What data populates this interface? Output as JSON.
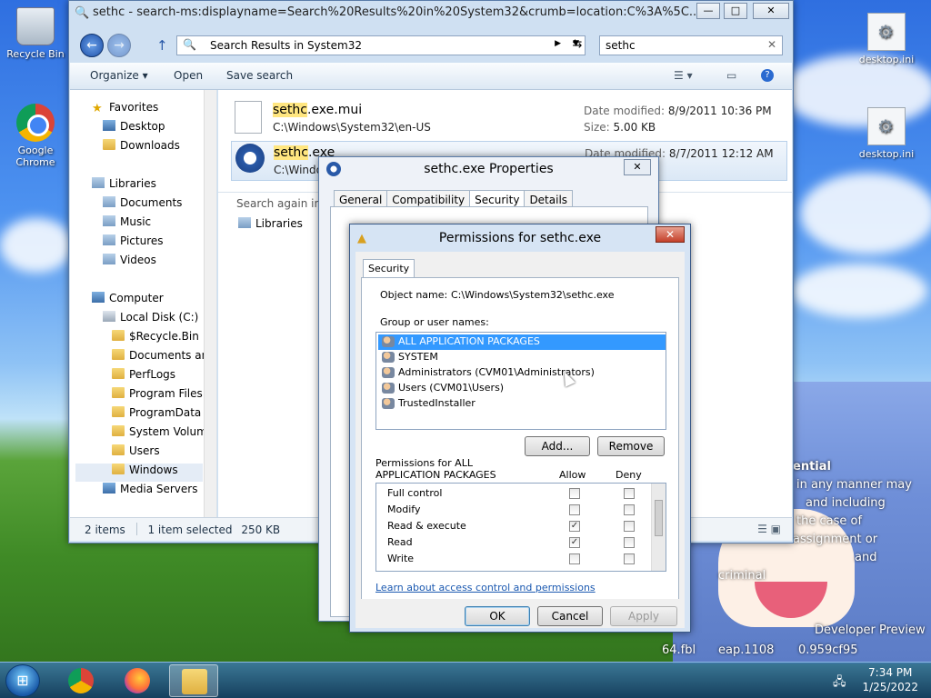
{
  "desktop": {
    "icons": [
      {
        "label": "Recycle Bin"
      },
      {
        "label": "Google Chrome"
      },
      {
        "label": "desktop.ini"
      },
      {
        "label": "desktop.ini"
      }
    ],
    "wallpaper_text": {
      "line1": "ential",
      "line2": "in any manner may",
      "line3": "and including",
      "line4": "the case of",
      "line5": "assignment or",
      "line6": "and",
      "line7": "criminal",
      "line8": "Developer Preview",
      "line9": "64.fbl",
      "line10": "eap.1108",
      "line11": "0.959cf95"
    }
  },
  "explorer": {
    "title": "sethc - search-ms:displayname=Search%20Results%20in%20System32&crumb=location:C%3A%5C...",
    "window_buttons": {
      "minimize": "—",
      "maximize": "□",
      "close": "✕"
    },
    "back_button": "←",
    "forward_button": "→",
    "up_button": "↑",
    "address": "Search Results in System32",
    "refresh_label": "⇆",
    "search_value": "sethc",
    "toolbar": {
      "organize": "Organize ▾",
      "open": "Open",
      "save_search": "Save search",
      "help": "?"
    },
    "nav": {
      "favorites": "Favorites",
      "desktop": "Desktop",
      "downloads": "Downloads",
      "libraries": "Libraries",
      "documents": "Documents",
      "music": "Music",
      "pictures": "Pictures",
      "videos": "Videos",
      "computer": "Computer",
      "local_disk": "Local Disk (C:)",
      "recycle": "$Recycle.Bin",
      "docs_and": "Documents an",
      "perflogs": "PerfLogs",
      "program_files": "Program Files",
      "program_data": "ProgramData",
      "system_volume": "System Volume",
      "users": "Users",
      "windows": "Windows",
      "media_servers": "Media Servers"
    },
    "files": [
      {
        "name_hl": "sethc",
        "name_rest": ".exe.mui",
        "path": "C:\\Windows\\System32\\en-US",
        "modified_label": "Date modified:",
        "modified": "8/9/2011 10:36 PM",
        "size_label": "Size:",
        "size": "5.00 KB"
      },
      {
        "name_hl": "sethc",
        "name_rest": ".exe",
        "path": "C:\\Windo",
        "modified_label": "Date modified:",
        "modified": "8/7/2011 12:12 AM"
      }
    ],
    "search_again": "Search again in:",
    "search_again_libraries": "Libraries",
    "status": {
      "items": "2 items",
      "selected": "1 item selected",
      "size": "250 KB"
    }
  },
  "properties": {
    "title": "sethc.exe Properties",
    "tabs": [
      "General",
      "Compatibility",
      "Security",
      "Details"
    ],
    "active_tab": "Security",
    "close": "✕"
  },
  "permissions": {
    "title": "Permissions for sethc.exe",
    "close": "✕",
    "tab": "Security",
    "object_name_label": "Object name:",
    "object_name": "C:\\Windows\\System32\\sethc.exe",
    "group_label": "Group or user names:",
    "users": [
      {
        "name": "ALL APPLICATION PACKAGES",
        "selected": true
      },
      {
        "name": "SYSTEM",
        "selected": false
      },
      {
        "name": "Administrators (CVM01\\Administrators)",
        "selected": false
      },
      {
        "name": "Users (CVM01\\Users)",
        "selected": false
      },
      {
        "name": "TrustedInstaller",
        "selected": false
      }
    ],
    "add_button": "Add...",
    "remove_button": "Remove",
    "perm_for_line1": "Permissions for ALL",
    "perm_for_line2": "APPLICATION PACKAGES",
    "allow_label": "Allow",
    "deny_label": "Deny",
    "permissions": [
      {
        "name": "Full control",
        "allow": false,
        "deny": false
      },
      {
        "name": "Modify",
        "allow": false,
        "deny": false
      },
      {
        "name": "Read & execute",
        "allow": true,
        "deny": false
      },
      {
        "name": "Read",
        "allow": true,
        "deny": false
      },
      {
        "name": "Write",
        "allow": false,
        "deny": false
      }
    ],
    "check_mark": "✓",
    "learn_link": "Learn about access control and permissions",
    "ok": "OK",
    "cancel": "Cancel",
    "apply": "Apply"
  },
  "taskbar": {
    "start": "⊞",
    "time": "7:34 PM",
    "date": "1/25/2022"
  }
}
